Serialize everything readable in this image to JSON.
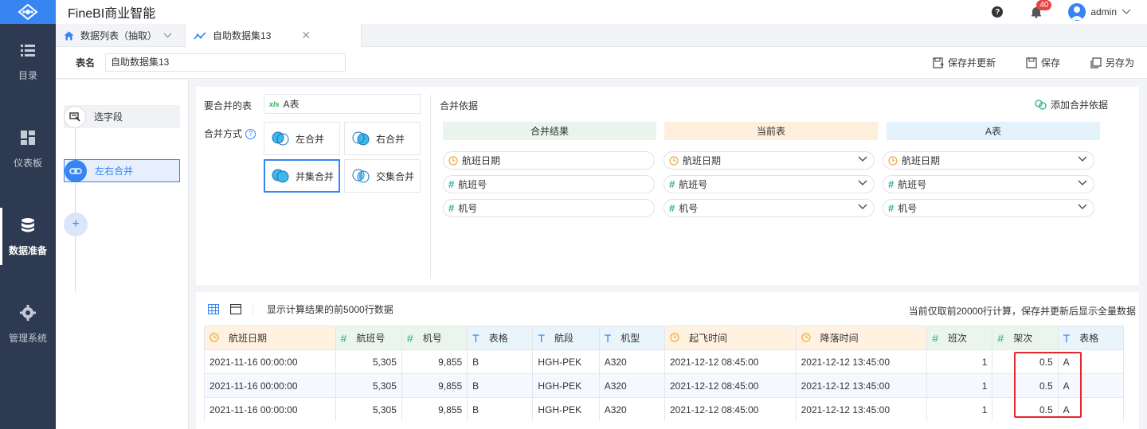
{
  "app": {
    "title": "FineBI商业智能"
  },
  "header": {
    "notification_count": "40",
    "user": "admin"
  },
  "nav": {
    "items": [
      {
        "label": "目录"
      },
      {
        "label": "仪表板"
      },
      {
        "label": "数据准备"
      },
      {
        "label": "管理系统"
      }
    ]
  },
  "tabs": [
    {
      "label": "数据列表（抽取）"
    },
    {
      "label": "自助数据集13"
    }
  ],
  "namebar": {
    "label": "表名",
    "value": "自助数据集13",
    "save_update": "保存并更新",
    "save": "保存",
    "save_as": "另存为"
  },
  "steps": [
    {
      "label": "选字段"
    },
    {
      "label": "左右合并"
    }
  ],
  "config": {
    "table_label": "要合并的表",
    "table_name": "A表",
    "method_label": "合并方式",
    "methods": [
      {
        "label": "左合并"
      },
      {
        "label": "右合并"
      },
      {
        "label": "并集合并"
      },
      {
        "label": "交集合并"
      }
    ],
    "selected_method": "并集合并",
    "basis_label": "合并依据",
    "add_basis": "添加合并依据",
    "columns": {
      "result": "合并结果",
      "current": "当前表",
      "other": "A表"
    },
    "rows": [
      {
        "result": "航班日期",
        "current": "航班日期",
        "other": "航班日期",
        "kind": "date"
      },
      {
        "result": "航班号",
        "current": "航班号",
        "other": "航班号",
        "kind": "number"
      },
      {
        "result": "机号",
        "current": "机号",
        "other": "机号",
        "kind": "number"
      }
    ]
  },
  "preview": {
    "caption": "显示计算结果的前5000行数据",
    "note": "当前仅取前20000行计算，保存并更新后显示全量数据",
    "headers": [
      {
        "label": "航班日期",
        "kind": "date"
      },
      {
        "label": "航班号",
        "kind": "number"
      },
      {
        "label": "机号",
        "kind": "number"
      },
      {
        "label": "表格",
        "kind": "text"
      },
      {
        "label": "航段",
        "kind": "text"
      },
      {
        "label": "机型",
        "kind": "text"
      },
      {
        "label": "起飞时间",
        "kind": "date"
      },
      {
        "label": "降落时间",
        "kind": "date"
      },
      {
        "label": "班次",
        "kind": "number"
      },
      {
        "label": "架次",
        "kind": "number"
      },
      {
        "label": "表格",
        "kind": "text"
      }
    ],
    "rows": [
      [
        "2021-11-16 00:00:00",
        "5,305",
        "9,855",
        "B",
        "HGH-PEK",
        "A320",
        "2021-12-12 08:45:00",
        "2021-12-12 13:45:00",
        "1",
        "0.5",
        "A"
      ],
      [
        "2021-11-16 00:00:00",
        "5,305",
        "9,855",
        "B",
        "HGH-PEK",
        "A320",
        "2021-12-12 08:45:00",
        "2021-12-12 13:45:00",
        "1",
        "0.5",
        "A"
      ],
      [
        "2021-11-16 00:00:00",
        "5,305",
        "9,855",
        "B",
        "HGH-PEK",
        "A320",
        "2021-12-12 08:45:00",
        "2021-12-12 13:45:00",
        "1",
        "0.5",
        "A"
      ]
    ]
  },
  "colors": {
    "accent": "#3685f2",
    "nav_bg": "#2d3a51",
    "highlight": "#e8242e"
  }
}
